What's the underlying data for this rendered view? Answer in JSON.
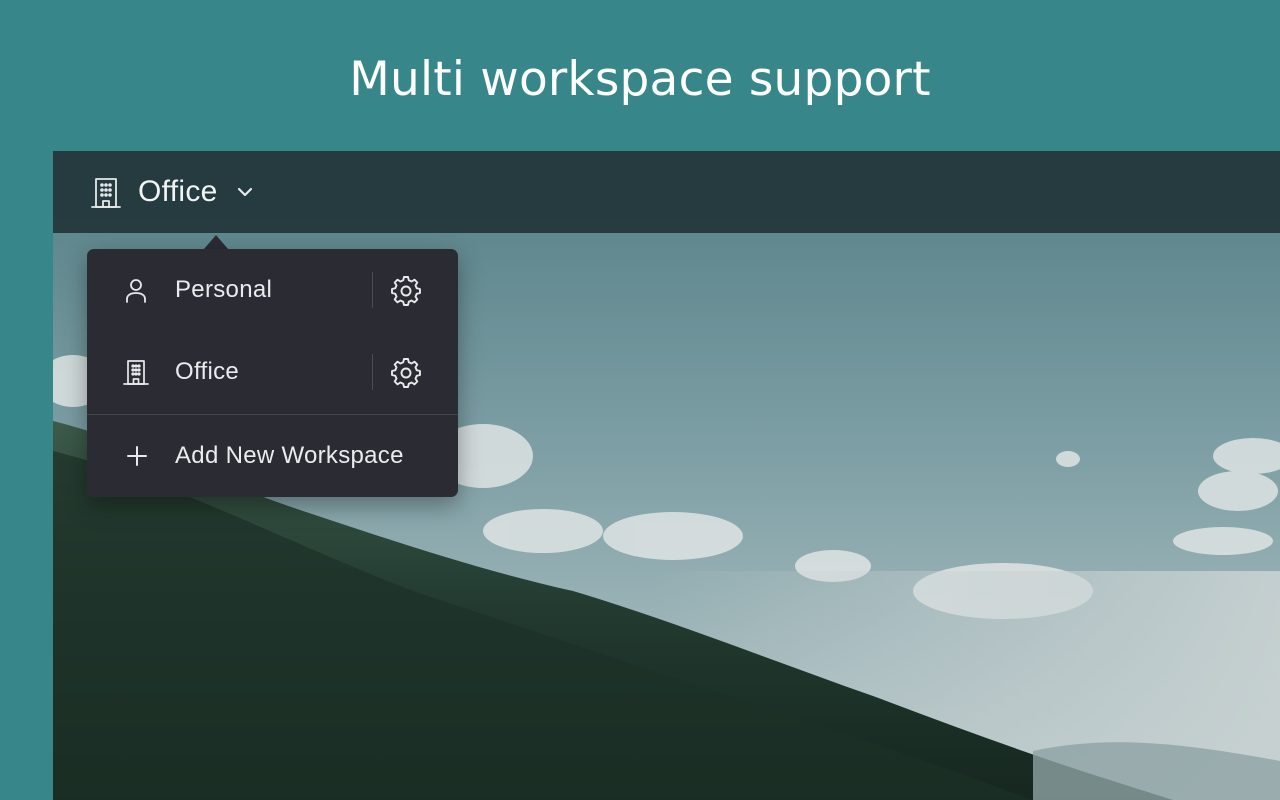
{
  "heading": "Multi workspace support",
  "current_workspace": "Office",
  "menu": {
    "workspaces": [
      {
        "label": "Personal",
        "icon": "user-icon"
      },
      {
        "label": "Office",
        "icon": "building-icon"
      }
    ],
    "add_label": "Add New Workspace"
  },
  "colors": {
    "background": "#37868a",
    "topbar": "#22363a",
    "menu": "#2b2c33",
    "text": "#e9ebee"
  }
}
